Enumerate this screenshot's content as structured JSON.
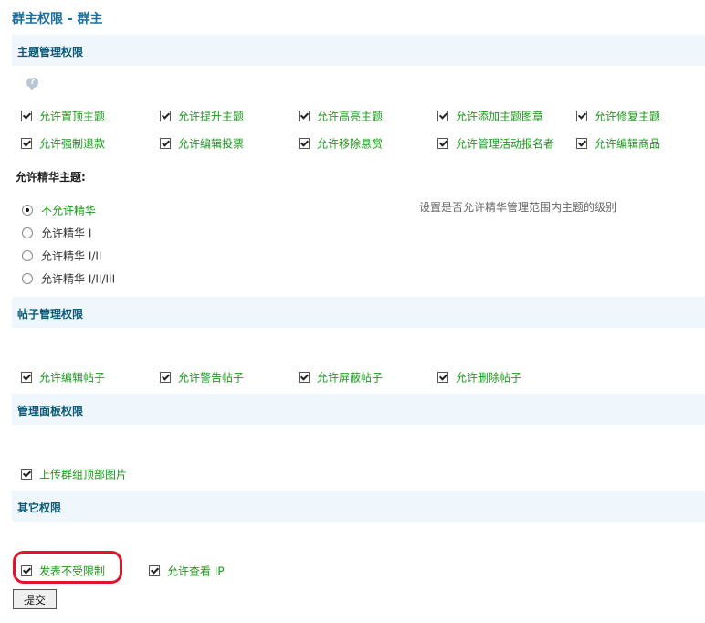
{
  "page": {
    "title": "群主权限 - 群主"
  },
  "sections": {
    "topic": "主题管理权限",
    "post": "帖子管理权限",
    "panel": "管理面板权限",
    "other": "其它权限"
  },
  "topic_permissions": [
    "允许置顶主题",
    "允许提升主题",
    "允许高亮主题",
    "允许添加主题图章",
    "允许修复主题",
    "允许强制退款",
    "允许编辑投票",
    "允许移除悬赏",
    "允许管理活动报名者",
    "允许编辑商品"
  ],
  "digest": {
    "label": "允许精华主题:",
    "hint": "设置是否允许精华管理范围内主题的级别",
    "options": [
      "不允许精华",
      "允许精华 I",
      "允许精华 I/II",
      "允许精华 I/II/III"
    ],
    "selected": "不允许精华"
  },
  "post_permissions": [
    "允许编辑帖子",
    "允许警告帖子",
    "允许屏蔽帖子",
    "允许删除帖子"
  ],
  "panel_permissions": [
    "上传群组顶部图片"
  ],
  "other_permissions": [
    "发表不受限制",
    "允许查看 IP"
  ],
  "submit_label": "提交",
  "icons": {
    "help": "question-bubble-icon"
  },
  "colors": {
    "section_bg": "#f0f7fc",
    "label_green": "#1a9a1a",
    "highlight": "#e0152a"
  }
}
